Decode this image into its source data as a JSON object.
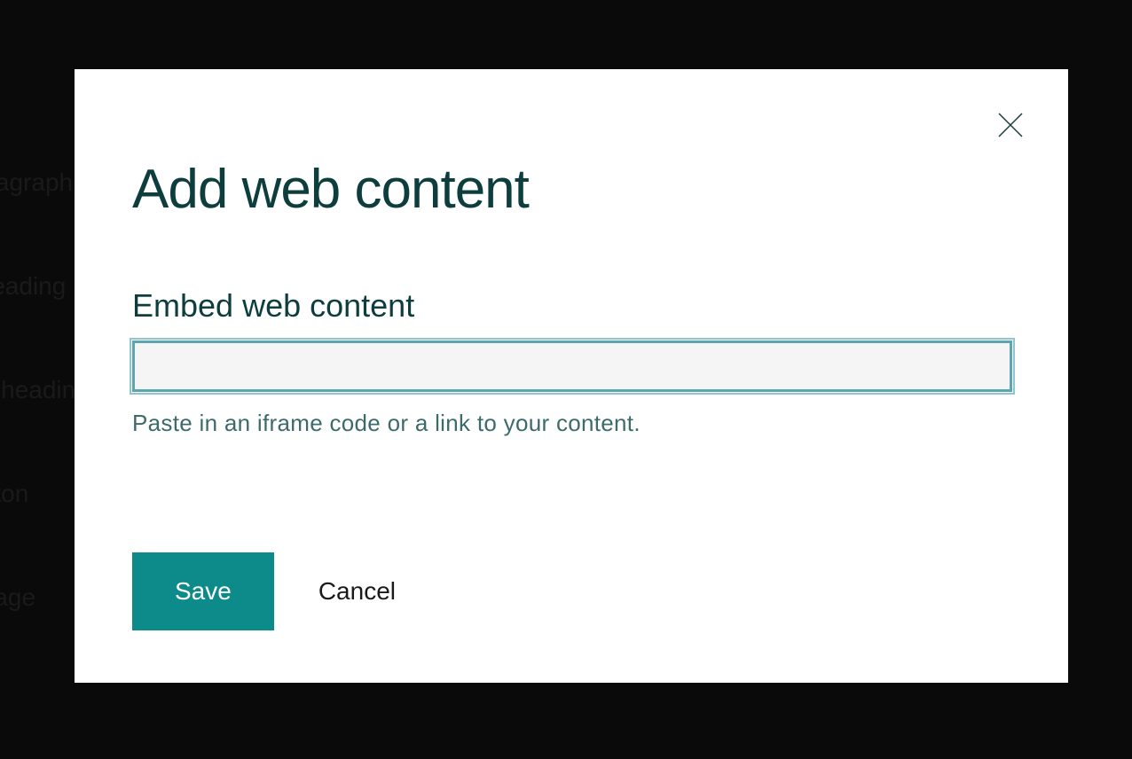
{
  "background": {
    "items": [
      "aragraph",
      "Heading",
      "ubheading",
      "utton",
      "mage"
    ]
  },
  "modal": {
    "title": "Add web content",
    "field_label": "Embed web content",
    "input_value": "",
    "hint": "Paste in an iframe code or a link to your content.",
    "save_label": "Save",
    "cancel_label": "Cancel"
  }
}
